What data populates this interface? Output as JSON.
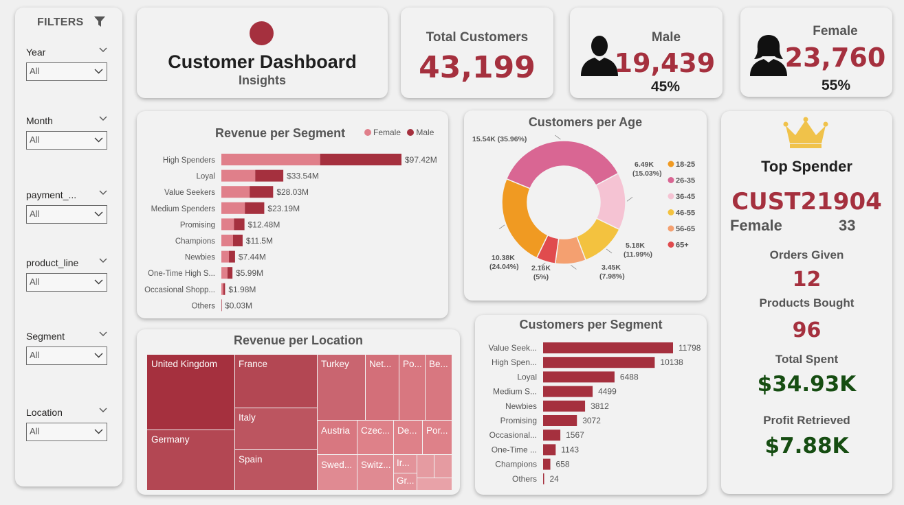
{
  "sidebar": {
    "title": "FILTERS",
    "filters": [
      {
        "label": "Year",
        "value": "All"
      },
      {
        "label": "Month",
        "value": "All"
      },
      {
        "label": "payment_...",
        "value": "All"
      },
      {
        "label": "product_line",
        "value": "All"
      },
      {
        "label": "Segment",
        "value": "All"
      },
      {
        "label": "Location",
        "value": "All"
      }
    ]
  },
  "header": {
    "title": "Customer Dashboard",
    "subtitle": "Insights"
  },
  "kpis": {
    "total_label": "Total Customers",
    "total_value": "43,199",
    "male_label": "Male",
    "male_value": "19,439",
    "male_pct": "45%",
    "female_label": "Female",
    "female_value": "23,760",
    "female_pct": "55%"
  },
  "colors": {
    "primary": "#a5303e",
    "female": "#e07f8a",
    "green": "#164d12",
    "gold": "#f0c24a"
  },
  "revenue_per_segment": {
    "title": "Revenue per Segment",
    "legend": [
      "Female",
      "Male"
    ],
    "chart_data": {
      "type": "bar",
      "orientation": "horizontal",
      "stacked": true,
      "categories": [
        "High Spenders",
        "Loyal",
        "Value Seekers",
        "Medium Spenders",
        "Promising",
        "Champions",
        "Newbies",
        "One-Time High S...",
        "Occasional Shopp...",
        "Others"
      ],
      "series": [
        {
          "name": "Female",
          "values": [
            53.4,
            18.3,
            15.3,
            12.7,
            6.8,
            6.3,
            4.1,
            3.3,
            1.1,
            0.02
          ]
        },
        {
          "name": "Male",
          "values": [
            44.0,
            15.2,
            12.7,
            10.5,
            5.7,
            5.2,
            3.3,
            2.7,
            0.9,
            0.01
          ]
        }
      ],
      "total_labels": [
        "$97.42M",
        "$33.54M",
        "$28.03M",
        "$23.19M",
        "$12.48M",
        "$11.5M",
        "$7.44M",
        "$5.99M",
        "$1.98M",
        "$0.03M"
      ],
      "unit": "$M"
    }
  },
  "customers_per_age": {
    "title": "Customers per Age",
    "chart_data": {
      "type": "pie",
      "donut": true,
      "categories": [
        "26-35",
        "36-45",
        "46-55",
        "56-65",
        "65+",
        "18-25"
      ],
      "values": [
        15.54,
        6.49,
        5.18,
        3.45,
        2.16,
        10.38
      ],
      "labels": [
        "15.54K (35.96%)",
        "6.49K (15.03%)",
        "5.18K (11.99%)",
        "3.45K (7.98%)",
        "2.16K (5%)",
        "10.38K (24.04%)"
      ],
      "colors": [
        "#d96693",
        "#f5c3d3",
        "#f3c23f",
        "#f4a070",
        "#e04b4e",
        "#f09a22"
      ],
      "legend": [
        {
          "name": "18-25",
          "color": "#f09a22"
        },
        {
          "name": "26-35",
          "color": "#d96693"
        },
        {
          "name": "36-45",
          "color": "#f5c3d3"
        },
        {
          "name": "46-55",
          "color": "#f3c23f"
        },
        {
          "name": "56-65",
          "color": "#f4a070"
        },
        {
          "name": "65+",
          "color": "#e04b4e"
        }
      ],
      "legend_position": "right"
    }
  },
  "customers_per_segment": {
    "title": "Customers per Segment",
    "chart_data": {
      "type": "bar",
      "orientation": "horizontal",
      "categories": [
        "Value Seek...",
        "High Spen...",
        "Loyal",
        "Medium S...",
        "Newbies",
        "Promising",
        "Occasional...",
        "One-Time ...",
        "Champions",
        "Others"
      ],
      "values": [
        11798,
        10138,
        6488,
        4499,
        3812,
        3072,
        1567,
        1143,
        658,
        24
      ]
    }
  },
  "revenue_per_location": {
    "title": "Revenue per Location",
    "tiles": [
      "United Kingdom",
      "Germany",
      "France",
      "Italy",
      "Spain",
      "Turkey",
      "Net...",
      "Po...",
      "Be...",
      "Austria",
      "Czec...",
      "De...",
      "Por...",
      "Swed...",
      "Switz...",
      "Ir...",
      "Gr..."
    ]
  },
  "top_spender": {
    "title": "Top Spender",
    "customer_id": "CUST21904",
    "gender": "Female",
    "age": "33",
    "orders_label": "Orders Given",
    "orders_value": "12",
    "products_label": "Products Bought",
    "products_value": "96",
    "spent_label": "Total Spent",
    "spent_value": "$34.93K",
    "profit_label": "Profit Retrieved",
    "profit_value": "$7.88K"
  }
}
